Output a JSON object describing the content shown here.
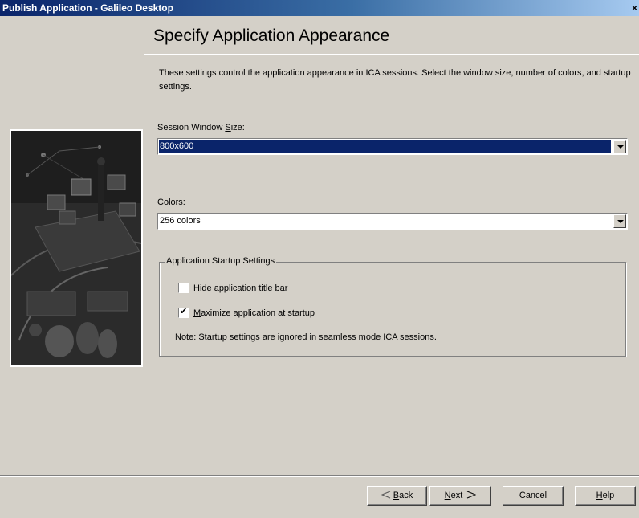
{
  "window": {
    "title": "Publish Application - Galileo Desktop",
    "close_glyph": "×"
  },
  "page": {
    "heading": "Specify Application Appearance",
    "description": "These settings control the application appearance in ICA sessions.  Select the window size, number of colors, and startup settings."
  },
  "session_size": {
    "label_pre": "Session Window ",
    "label_ul": "S",
    "label_post": "ize:",
    "value": "800x600"
  },
  "colors": {
    "label_pre": "Co",
    "label_ul": "l",
    "label_post": "ors:",
    "value": "256 colors"
  },
  "startup": {
    "legend": "Application Startup Settings",
    "hide_title": {
      "pre": "Hide ",
      "ul": "a",
      "post": "pplication title bar",
      "checked": false
    },
    "maximize": {
      "pre": "",
      "ul": "M",
      "post": "aximize application at startup",
      "checked": true
    },
    "note": "Note: Startup settings are ignored in seamless mode ICA sessions."
  },
  "buttons": {
    "back_pre": "",
    "back_ul": "B",
    "back_post": "ack",
    "next_pre": "",
    "next_ul": "N",
    "next_post": "ext",
    "cancel": "Cancel",
    "help_pre": "",
    "help_ul": "H",
    "help_post": "elp"
  },
  "colors_theme": {
    "titlebar": "#0a246a",
    "selection": "#0a246a",
    "face": "#d4d0c8"
  }
}
